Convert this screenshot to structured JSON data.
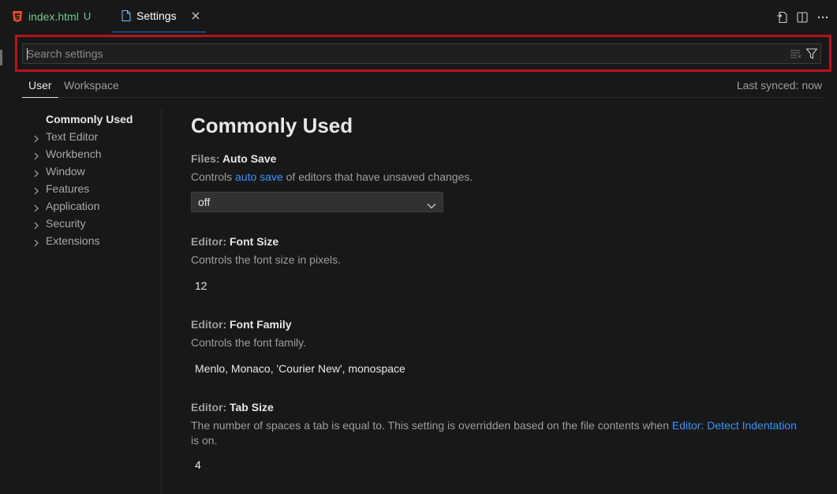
{
  "tabs": [
    {
      "label": "index.html",
      "badge": "U"
    },
    {
      "label": "Settings"
    }
  ],
  "search": {
    "placeholder": "Search settings",
    "value": ""
  },
  "scope_tabs": {
    "user": "User",
    "workspace": "Workspace"
  },
  "sync_status": "Last synced: now",
  "toc": [
    {
      "label": "Commonly Used",
      "expandable": false,
      "active": true
    },
    {
      "label": "Text Editor",
      "expandable": true
    },
    {
      "label": "Workbench",
      "expandable": true
    },
    {
      "label": "Window",
      "expandable": true
    },
    {
      "label": "Features",
      "expandable": true
    },
    {
      "label": "Application",
      "expandable": true
    },
    {
      "label": "Security",
      "expandable": true
    },
    {
      "label": "Extensions",
      "expandable": true
    }
  ],
  "section_title": "Commonly Used",
  "settings": {
    "auto_save": {
      "category": "Files: ",
      "name": "Auto Save",
      "desc_pre": "Controls ",
      "desc_link": "auto save",
      "desc_post": " of editors that have unsaved changes.",
      "value": "off"
    },
    "font_size": {
      "category": "Editor: ",
      "name": "Font Size",
      "desc": "Controls the font size in pixels.",
      "value": "12"
    },
    "font_family": {
      "category": "Editor: ",
      "name": "Font Family",
      "desc": "Controls the font family.",
      "value": "Menlo, Monaco, 'Courier New', monospace"
    },
    "tab_size": {
      "category": "Editor: ",
      "name": "Tab Size",
      "desc_pre": "The number of spaces a tab is equal to. This setting is overridden based on the file contents when ",
      "desc_link": "Editor: Detect Indentation",
      "desc_post": " is on.",
      "value": "4"
    }
  },
  "icons": {
    "html_file": "html5-icon",
    "settings_file": "file-icon",
    "close": "close-icon",
    "open_json": "open-settings-json-icon",
    "split": "split-editor-icon",
    "more": "more-actions-icon",
    "clear": "clear-filter-icon",
    "filter": "filter-icon"
  },
  "colors": {
    "highlight": "#b5131a",
    "link": "#3794ff",
    "git_untracked": "#73c991",
    "active_tab_border": "#0078d4"
  }
}
